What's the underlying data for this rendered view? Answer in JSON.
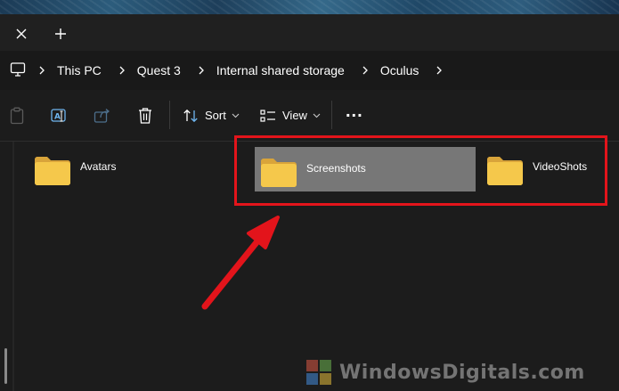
{
  "window": {
    "new_tab_label": "+"
  },
  "address": {
    "items": [
      {
        "label": "This PC"
      },
      {
        "label": "Quest 3"
      },
      {
        "label": "Internal shared storage"
      },
      {
        "label": "Oculus"
      }
    ]
  },
  "toolbar": {
    "sort_label": "Sort",
    "view_label": "View",
    "more_label": "..."
  },
  "files": [
    {
      "name": "Avatars",
      "selected": false
    },
    {
      "name": "Screenshots",
      "selected": true
    },
    {
      "name": "VideoShots",
      "selected": false
    }
  ],
  "watermark": {
    "text": "WindowsDigitals.com"
  },
  "colors": {
    "highlight": "#e3141b",
    "folder": "#f5c84b",
    "selection": "#777777"
  }
}
